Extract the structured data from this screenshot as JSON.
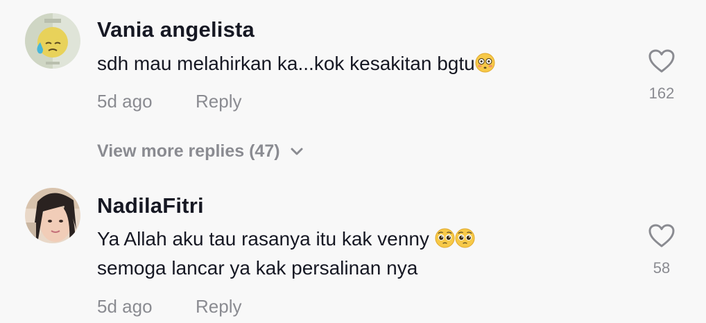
{
  "comments": [
    {
      "username": "Vania angelista",
      "text_line1": "sdh mau melahirkan ka...kok kesakitan bgtu",
      "emoji_line1": "flushed-face",
      "age": "5d ago",
      "reply_label": "Reply",
      "like_count": "162",
      "avatar": "crying-face-avatar"
    },
    {
      "username": "NadilaFitri",
      "text_line1": "Ya Allah aku tau rasanya itu kak venny",
      "emoji_line1": "pleading-face",
      "text_line2": "semoga lancar ya kak persalinan nya",
      "age": "5d ago",
      "reply_label": "Reply",
      "like_count": "58",
      "avatar": "user-photo-avatar"
    }
  ],
  "view_more": {
    "label": "View more replies (47)",
    "icon": "chevron-down-icon"
  },
  "colors": {
    "background": "#f8f8f8",
    "primary_text": "#161823",
    "secondary_text": "#8a8b91"
  }
}
